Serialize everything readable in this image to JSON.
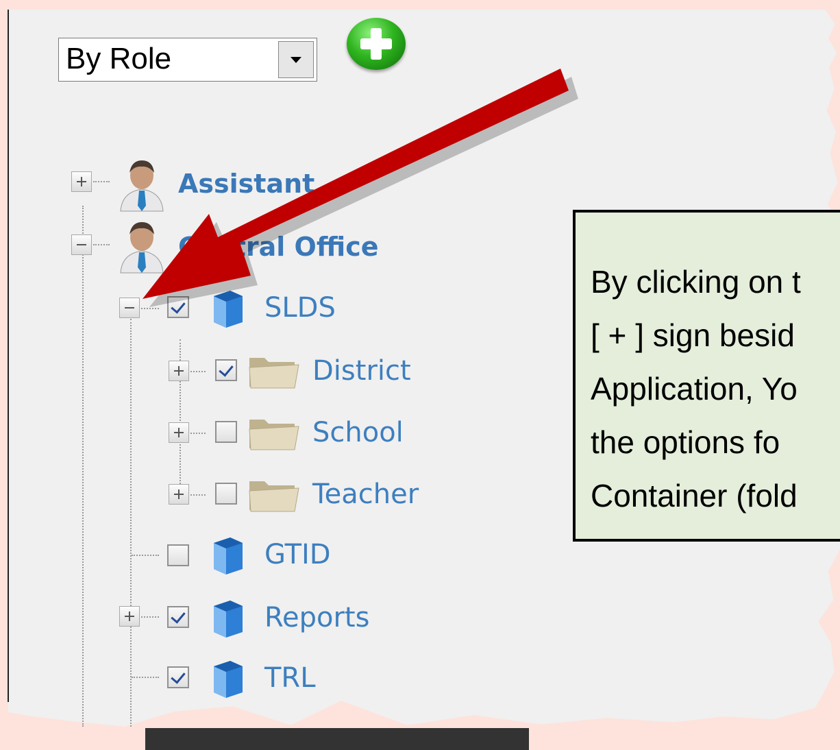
{
  "toolbar": {
    "view_select": {
      "value": "By Role"
    },
    "add_button_icon": "plus-circle-icon"
  },
  "tree": {
    "roles": [
      {
        "label": "Assistant",
        "expanded": false,
        "icon": "user-role-icon"
      },
      {
        "label": "Central Office",
        "expanded": true,
        "icon": "user-role-icon"
      }
    ],
    "applications": [
      {
        "label": "SLDS",
        "checked": true,
        "expanded": true,
        "icon": "application-cube-icon"
      },
      {
        "label": "GTID",
        "checked": false,
        "icon": "application-cube-icon"
      },
      {
        "label": "Reports",
        "checked": true,
        "expanded": false,
        "icon": "application-cube-icon"
      },
      {
        "label": "TRL",
        "checked": true,
        "icon": "application-cube-icon"
      }
    ],
    "containers": [
      {
        "label": "District",
        "checked": true,
        "icon": "folder-icon"
      },
      {
        "label": "School",
        "checked": false,
        "icon": "folder-icon"
      },
      {
        "label": "Teacher",
        "checked": false,
        "icon": "folder-icon"
      }
    ]
  },
  "callout": {
    "text": "By clicking on t\n[ + ] sign besid\nApplication, Yo\nthe options fo\nContainer (fold"
  },
  "colors": {
    "arrow": "#c00000",
    "callout_bg": "#e4eedb",
    "page_bg": "#fde3dc",
    "link_blue": "#3d7fbf"
  }
}
